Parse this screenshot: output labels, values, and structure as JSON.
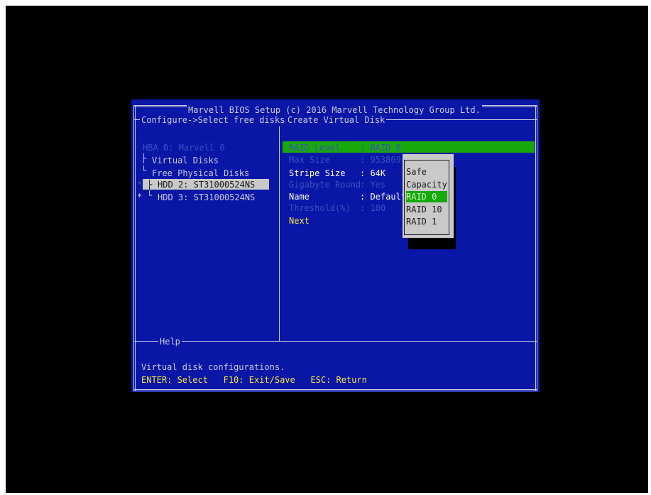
{
  "header": {
    "title": "Marvell BIOS Setup (c) 2016 Marvell Technology Group Ltd.",
    "breadcrumb": "Configure->Select free disks",
    "panel_title": "Create Virtual Disk"
  },
  "tree": {
    "root": "HBA 0: Marvell 0",
    "virtual_disks": "Virtual Disks",
    "free_physical_disks": "Free Physical Disks",
    "disks": [
      {
        "marker": "*",
        "label": "HDD 2: ST31000524NS",
        "selected": true
      },
      {
        "marker": "*",
        "label": "HDD 3: ST31000524NS",
        "selected": false
      }
    ]
  },
  "form": {
    "raid_level": {
      "label": "RAID Level",
      "value": ": RAID 0"
    },
    "max_size": {
      "label": "Max Size",
      "value": ": 953869"
    },
    "stripe_size": {
      "label": "Stripe Size",
      "value": ": 64K"
    },
    "gigabyte_round": {
      "label": "Gigabyte Round",
      "value": ": Yes"
    },
    "name": {
      "label": "Name",
      "value": ": Default"
    },
    "threshold": {
      "label": "Threshold(%)",
      "value": ": 100"
    },
    "next": "Next"
  },
  "popup": {
    "options": [
      "Safe",
      "Capacity",
      "RAID 0",
      "RAID 10",
      "RAID 1"
    ],
    "selected": "RAID 0"
  },
  "help": {
    "title": "Help",
    "description": "Virtual disk configurations.",
    "keys": "ENTER: Select   F10: Exit/Save   ESC: Return"
  }
}
